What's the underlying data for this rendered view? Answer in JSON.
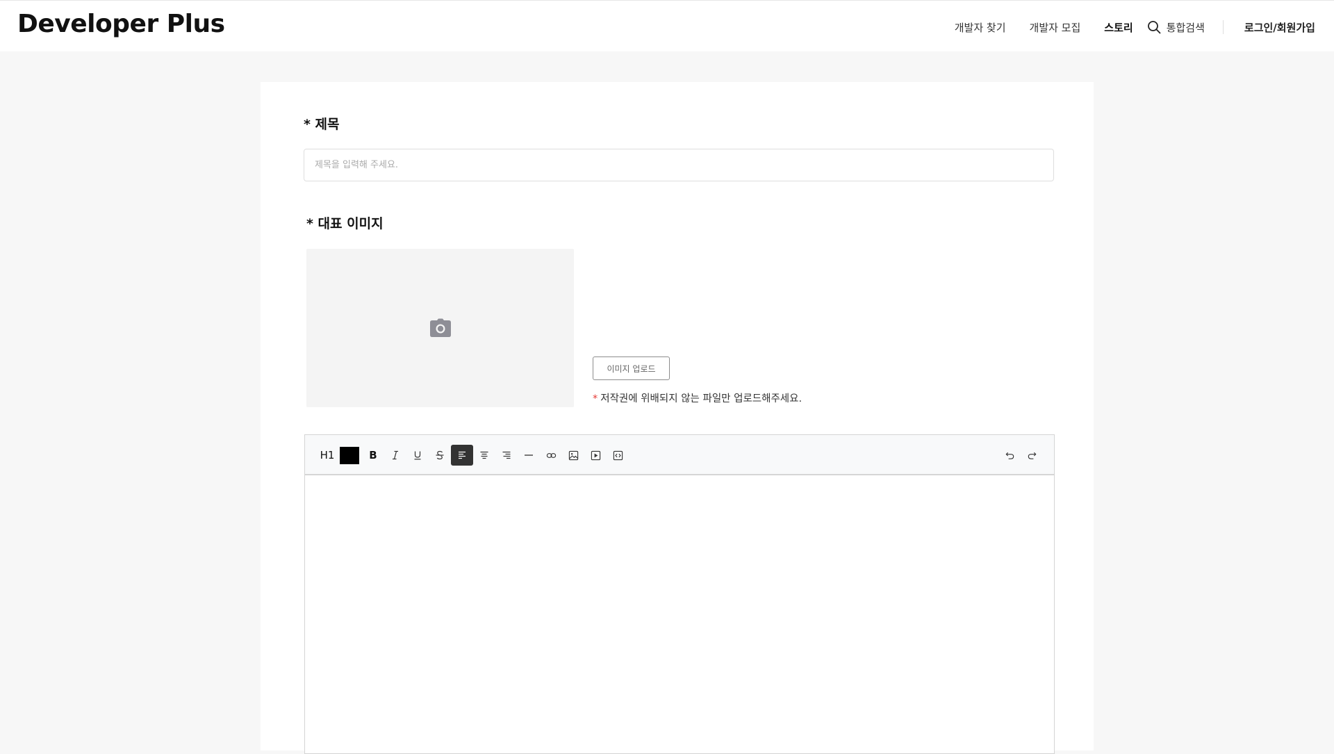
{
  "header": {
    "logo": "Developer Plus",
    "nav": {
      "find_developers": "개발자 찾기",
      "recruit_developers": "개발자 모집",
      "story": "스토리",
      "search": "통합검색",
      "login": "로그인/회원가입"
    }
  },
  "form": {
    "title_label": "* 제목",
    "title_placeholder": "제목을 입력해 주세요.",
    "title_value": "",
    "image_label": "* 대표 이미지",
    "upload_button": "이미지 업로드",
    "notice_star": "*",
    "notice_text": "저작권에 위배되지 않는 파일만 업로드해주세요."
  },
  "editor": {
    "toolbar": {
      "heading": "H1",
      "text_color": "#000000",
      "bold": "B",
      "items": [
        "heading",
        "text-color",
        "bold",
        "italic",
        "underline",
        "strikethrough",
        "align-left",
        "align-center",
        "align-right",
        "horizontal-rule",
        "link",
        "image",
        "video",
        "code-block",
        "undo",
        "redo"
      ],
      "active": "align-left"
    },
    "content": ""
  },
  "colors": {
    "accent_dark": "#333333",
    "required_star": "#e53935",
    "page_bg": "#f7f7f7"
  }
}
